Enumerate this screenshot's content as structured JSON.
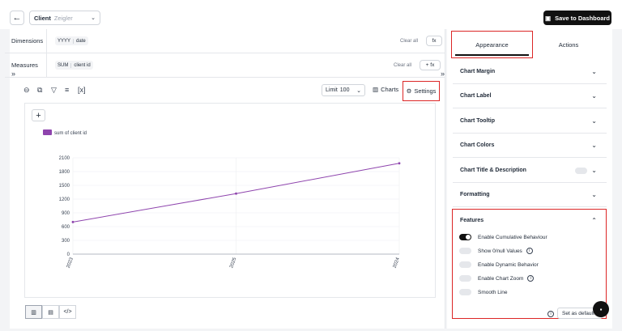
{
  "header": {
    "client_label": "Client",
    "client_value": "Zeigler",
    "save_label": "Save to Dashboard"
  },
  "query": {
    "dimensions_label": "Dimensions",
    "dimension_chip": {
      "fn": "YYYY",
      "field": "date"
    },
    "measures_label": "Measures",
    "measure_chip": {
      "fn": "SUM",
      "field": "client id"
    },
    "clear_label": "Clear all",
    "fx_label": "fx",
    "add_fx_label": "+ fx"
  },
  "toolbar": {
    "formula_label": "[x]",
    "limit_label": "Limit",
    "limit_value": "100",
    "charts_label": "Charts",
    "settings_label": "Settings"
  },
  "chart_data": {
    "type": "line",
    "x": [
      "2023",
      "2025",
      "2024"
    ],
    "series": [
      {
        "name": "sum of client id",
        "values": [
          700,
          1320,
          1980
        ],
        "color": "#8e44ad"
      }
    ],
    "yticks": [
      0,
      300,
      600,
      900,
      1200,
      1500,
      1800,
      2100
    ],
    "ylim": [
      0,
      2100
    ],
    "grid": true,
    "legend": "top-left"
  },
  "panel": {
    "tabs": [
      "Appearance",
      "Actions"
    ],
    "sections": [
      "Chart Margin",
      "Chart Label",
      "Chart Tooltip",
      "Chart Colors",
      "Chart Title & Description",
      "Formatting"
    ],
    "features_title": "Features",
    "features": [
      {
        "label": "Enable Cumulative Behaviour",
        "on": true,
        "info": false
      },
      {
        "label": "Show 0/null Values",
        "on": false,
        "info": true
      },
      {
        "label": "Enable Dynamic Behavior",
        "on": false,
        "info": false
      },
      {
        "label": "Enable Chart Zoom",
        "on": false,
        "info": true
      },
      {
        "label": "Smooth Line",
        "on": false,
        "info": false
      }
    ],
    "set_default_label": "Set as default"
  },
  "colors": {
    "accent": "#111111",
    "highlight": "#dc2626",
    "series": "#8e44ad"
  }
}
